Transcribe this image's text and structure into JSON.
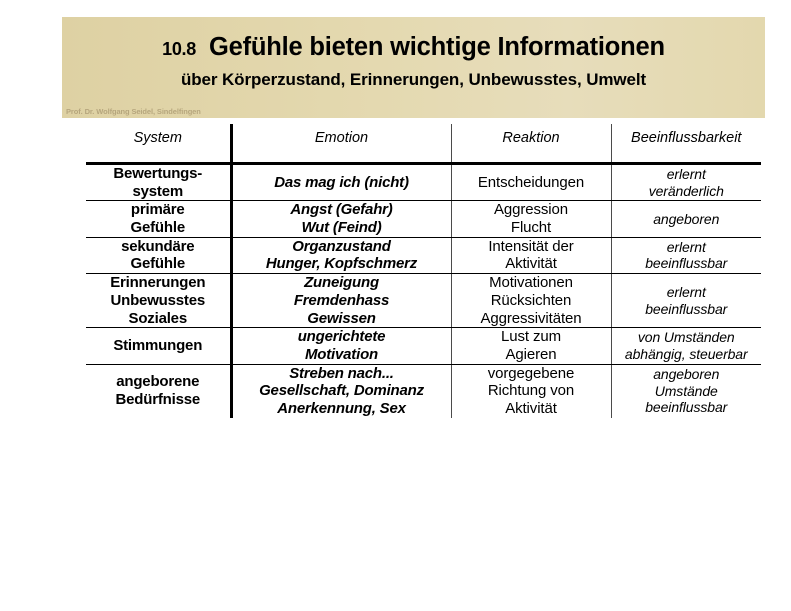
{
  "slide": {
    "number": "10.8",
    "title": "Gefühle bieten wichtige Informationen",
    "subtitle": "über Körperzustand, Erinnerungen, Unbewusstes, Umwelt",
    "credit": "Prof. Dr. Wolfgang Seidel, Sindelfingen",
    "banner_color": "#e0d3a6",
    "credit_color": "#b6a67d"
  },
  "table": {
    "headers": [
      "System",
      "Emotion",
      "Reaktion",
      "Beeinflussbarkeit"
    ],
    "rows": [
      {
        "system": [
          "Bewertungs-",
          "system"
        ],
        "emotion": [
          "Das mag ich (nicht)"
        ],
        "reaktion": [
          "Entscheidungen"
        ],
        "beeinflussbarkeit": [
          "erlernt",
          "veränderlich"
        ]
      },
      {
        "system": [
          "primäre",
          "Gefühle"
        ],
        "emotion": [
          "Angst (Gefahr)",
          "Wut (Feind)"
        ],
        "reaktion": [
          "Aggression",
          "Flucht"
        ],
        "beeinflussbarkeit": [
          "angeboren"
        ]
      },
      {
        "system": [
          "sekundäre",
          "Gefühle"
        ],
        "emotion": [
          "Organzustand",
          "Hunger, Kopfschmerz"
        ],
        "reaktion": [
          "Intensität der",
          "Aktivität"
        ],
        "beeinflussbarkeit": [
          "erlernt",
          "beeinflussbar"
        ]
      },
      {
        "system": [
          "Erinnerungen",
          "Unbewusstes",
          "Soziales"
        ],
        "emotion": [
          "Zuneigung",
          "Fremdenhass",
          "Gewissen"
        ],
        "reaktion": [
          "Motivationen",
          "Rücksichten",
          "Aggressivitäten"
        ],
        "beeinflussbarkeit": [
          "erlernt",
          "beeinflussbar"
        ]
      },
      {
        "system": [
          "Stimmungen"
        ],
        "emotion": [
          "ungerichtete",
          "Motivation"
        ],
        "reaktion": [
          "Lust zum",
          "Agieren"
        ],
        "beeinflussbarkeit": [
          "von Umständen",
          "abhängig, steuerbar"
        ]
      },
      {
        "system": [
          "angeborene",
          "Bedürfnisse"
        ],
        "emotion": [
          "Streben nach...",
          "Gesellschaft, Dominanz",
          "Anerkennung, Sex"
        ],
        "reaktion": [
          "vorgegebene",
          "Richtung von",
          "Aktivität"
        ],
        "beeinflussbarkeit": [
          "angeboren",
          "Umstände",
          "beeinflussbar"
        ]
      }
    ]
  }
}
